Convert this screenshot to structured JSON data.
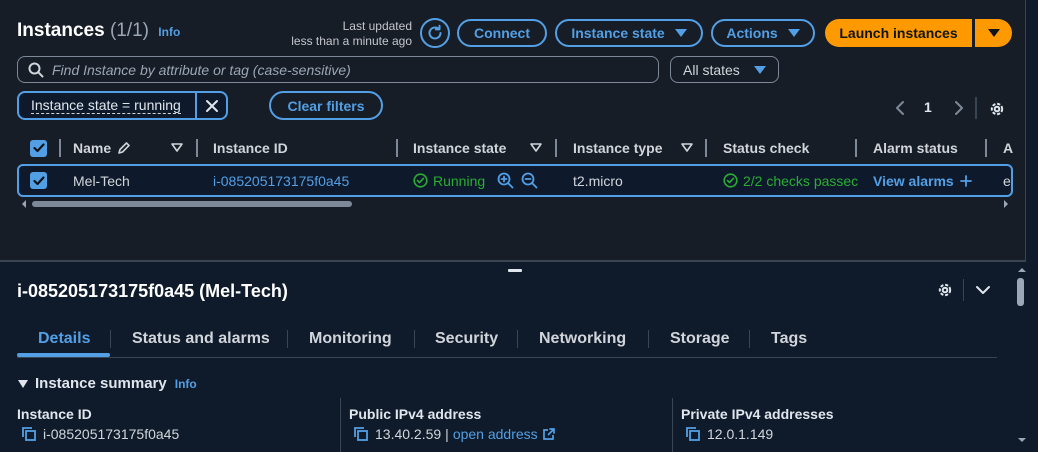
{
  "header": {
    "title": "Instances",
    "count": "(1/1)",
    "info": "Info",
    "last_updated_line1": "Last updated",
    "last_updated_line2": "less than a minute ago"
  },
  "toolbar": {
    "connect": "Connect",
    "instance_state": "Instance state",
    "actions": "Actions",
    "launch": "Launch instances"
  },
  "search": {
    "placeholder": "Find Instance by attribute or tag (case-sensitive)",
    "states_select": "All states"
  },
  "filters": {
    "token": "Instance state = running",
    "clear": "Clear filters"
  },
  "pagination": {
    "page": "1"
  },
  "table": {
    "headers": {
      "name": "Name",
      "instance_id": "Instance ID",
      "instance_state": "Instance state",
      "instance_type": "Instance type",
      "status_check": "Status check",
      "alarm_status": "Alarm status",
      "next": "A"
    },
    "row": {
      "name": "Mel-Tech",
      "instance_id": "i-085205173175f0a45",
      "state": "Running",
      "type": "t2.micro",
      "status": "2/2 checks passec",
      "alarm": "View alarms",
      "next": "e"
    }
  },
  "details": {
    "title": "i-085205173175f0a45 (Mel-Tech)",
    "tabs": [
      "Details",
      "Status and alarms",
      "Monitoring",
      "Security",
      "Networking",
      "Storage",
      "Tags"
    ],
    "summary": "Instance summary",
    "info": "Info",
    "fields": {
      "instance_id_label": "Instance ID",
      "instance_id_value": "i-085205173175f0a45",
      "public_ip_label": "Public IPv4 address",
      "public_ip_value": "13.40.2.59",
      "public_ip_sep": "|",
      "public_ip_link": "open address",
      "private_ip_label": "Private IPv4 addresses",
      "private_ip_value": "12.0.1.149"
    }
  },
  "colors": {
    "accent": "#539fe5",
    "primary": "#ff9900",
    "success": "#29ad32",
    "panel": "#161d26"
  }
}
